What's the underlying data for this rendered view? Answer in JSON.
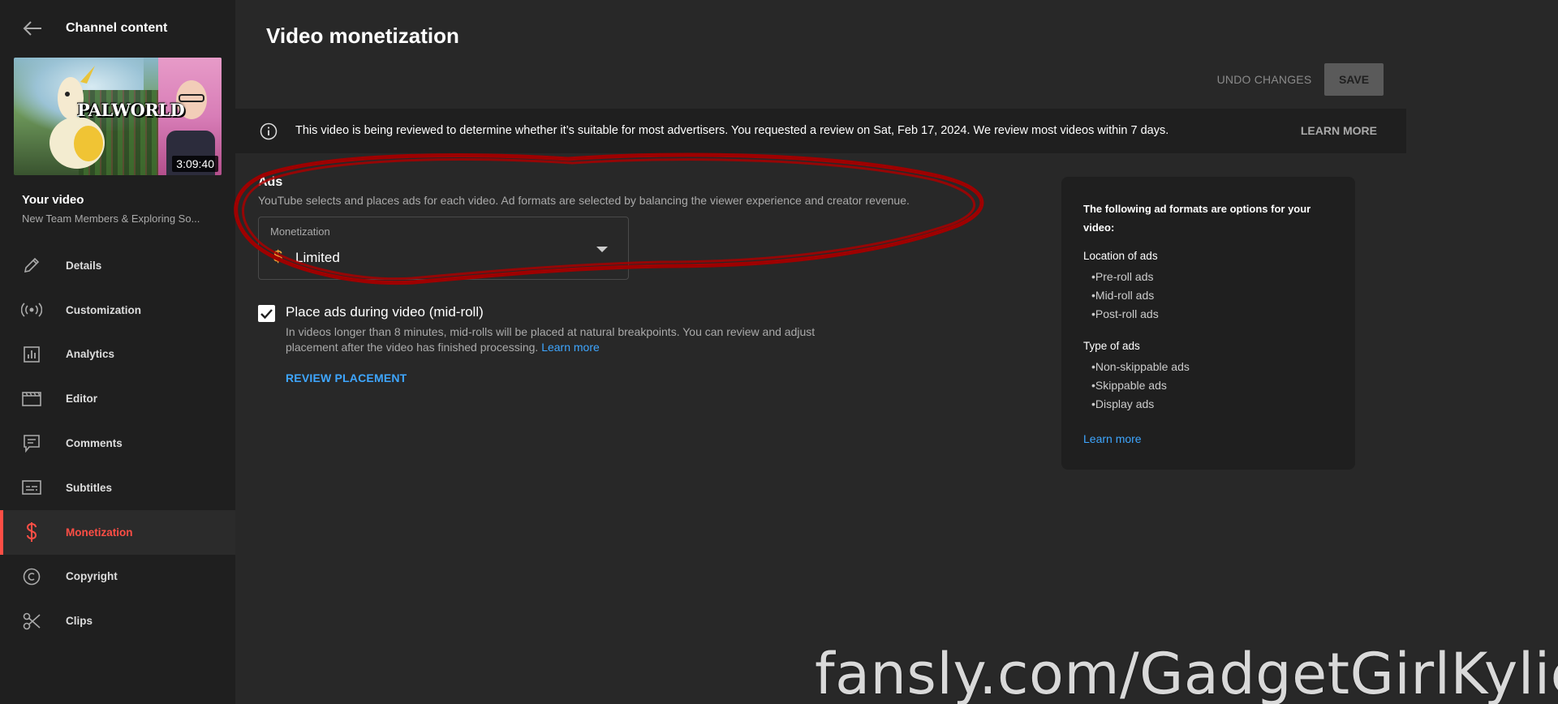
{
  "sidebar": {
    "title": "Channel content",
    "video": {
      "thumbnail_logo": "PALWORLD",
      "duration": "3:09:40",
      "heading": "Your video",
      "subtitle": "New Team Members & Exploring So..."
    },
    "items": [
      {
        "label": "Details",
        "icon": "pencil-icon"
      },
      {
        "label": "Customization",
        "icon": "broadcast-icon"
      },
      {
        "label": "Analytics",
        "icon": "bar-chart-icon"
      },
      {
        "label": "Editor",
        "icon": "clapperboard-icon"
      },
      {
        "label": "Comments",
        "icon": "comment-icon"
      },
      {
        "label": "Subtitles",
        "icon": "subtitles-icon"
      },
      {
        "label": "Monetization",
        "icon": "dollar-icon",
        "active": true
      },
      {
        "label": "Copyright",
        "icon": "copyright-icon"
      },
      {
        "label": "Clips",
        "icon": "scissors-icon"
      }
    ]
  },
  "header": {
    "title": "Video monetization",
    "undo_label": "UNDO CHANGES",
    "save_label": "SAVE"
  },
  "banner": {
    "text": "This video is being reviewed to determine whether it’s suitable for most advertisers. You requested a review on Sat, Feb 17, 2024. We review most videos within 7 days.",
    "learn_more": "LEARN MORE"
  },
  "ads": {
    "title": "Ads",
    "description": "YouTube selects and places ads for each video. Ad formats are selected by balancing the viewer experience and creator revenue.",
    "monetization_label": "Monetization",
    "monetization_value": "Limited",
    "midroll": {
      "checked": true,
      "label": "Place ads during video (mid-roll)",
      "description": "In videos longer than 8 minutes, mid-rolls will be placed at natural breakpoints. You can review and adjust placement after the video has finished processing.",
      "learn_more": "Learn more",
      "review_label": "REVIEW PLACEMENT"
    }
  },
  "formats": {
    "heading": "The following ad formats are options for your video:",
    "location_title": "Location of ads",
    "location_items": [
      "•Pre-roll ads",
      "•Mid-roll ads",
      "•Post-roll ads"
    ],
    "type_title": "Type of ads",
    "type_items": [
      "•Non-skippable ads",
      "•Skippable ads",
      "•Display ads"
    ],
    "learn_more": "Learn more"
  },
  "watermark": "fansly.com/GadgetGirlKylie",
  "colors": {
    "accent_red": "#ff4e45",
    "link_blue": "#3ea6ff",
    "dollar_orange": "#f4a938",
    "annotation_red": "#a00000"
  }
}
